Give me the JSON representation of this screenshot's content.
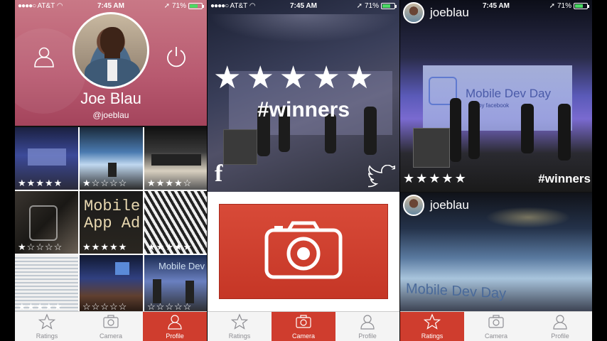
{
  "status": {
    "carrier": "AT&T",
    "time": "7:45 AM",
    "battery": "71%",
    "battery_level": 0.71
  },
  "tabs": {
    "ratings": "Ratings",
    "camera": "Camera",
    "profile": "Profile"
  },
  "profile": {
    "name": "Joe Blau",
    "handle": "@joeblau",
    "photos": [
      {
        "rating": 5
      },
      {
        "rating": 1
      },
      {
        "rating": 4
      },
      {
        "rating": 1
      },
      {
        "rating": 5
      },
      {
        "rating": 5
      },
      {
        "rating": 5
      },
      {
        "rating": 0
      },
      {
        "rating": 0
      }
    ],
    "photo_texts": {
      "mobile_ad": "Mobile App Ad",
      "mobile_dev": "Mobile Dev"
    }
  },
  "share": {
    "rating": 5,
    "caption": "#winners",
    "facebook": "f"
  },
  "feed": {
    "items": [
      {
        "user": "joeblau",
        "rating": 5,
        "caption": "#winners",
        "sign": "Mobile Dev Day",
        "sub": "by facebook"
      },
      {
        "user": "joeblau",
        "sign": "Mobile Dev Day"
      }
    ]
  },
  "colors": {
    "accent": "#cf3d2e",
    "battery": "#4cd964"
  },
  "icons": [
    "person-icon",
    "power-icon",
    "star-icon",
    "camera-icon",
    "facebook-icon",
    "twitter-icon",
    "location-arrow-icon",
    "wifi-icon"
  ]
}
